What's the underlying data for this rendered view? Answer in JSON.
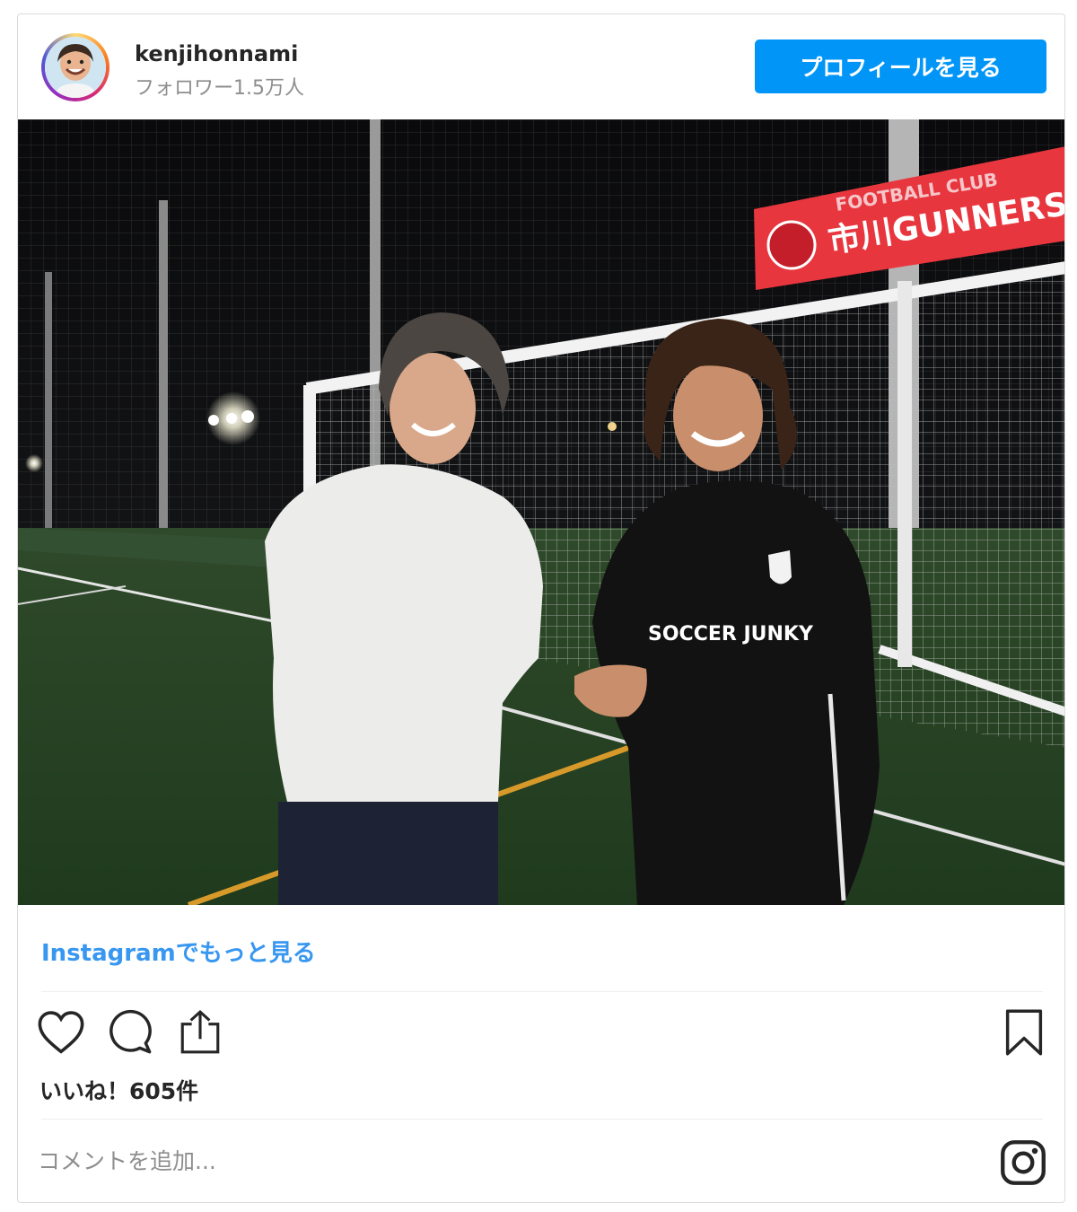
{
  "post": {
    "username": "kenjihonnami",
    "followers_text": "フォロワー1.5万人",
    "profile_button_label": "プロフィールを見る",
    "photo_banner": {
      "line1": "FOOTBALL CLUB",
      "line2": "市川GUNNERS"
    },
    "shirt_text": "SOCCER JUNKY",
    "more_link_text": "Instagramでもっと見る",
    "likes_text": "いいね！605件",
    "comment_placeholder": "コメントを追加..."
  },
  "icons": {
    "like": "heart-icon",
    "comment": "comment-icon",
    "share": "share-icon",
    "save": "bookmark-icon",
    "logo": "instagram-icon"
  },
  "colors": {
    "accent": "#0095f6",
    "link": "#3897f0",
    "banner": "#e8363f"
  }
}
